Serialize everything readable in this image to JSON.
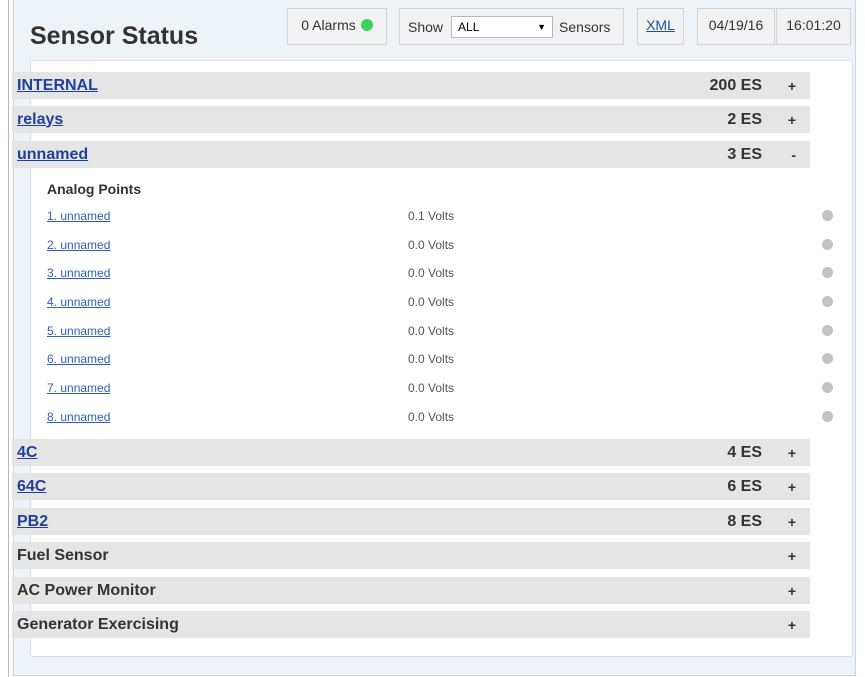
{
  "title": "Sensor Status",
  "alarms": {
    "label": "0 Alarms",
    "status_color": "#3fd35a"
  },
  "filter": {
    "show_label": "Show",
    "selected": "ALL",
    "sensors_label": "Sensors"
  },
  "xml_label": "XML",
  "date": "04/19/16",
  "time": "16:01:20",
  "groups": [
    {
      "name": "INTERNAL",
      "count": "200 ES",
      "toggle": "+"
    },
    {
      "name": "relays",
      "count": "2 ES",
      "toggle": "+"
    },
    {
      "name": "unnamed",
      "count": "3 ES",
      "toggle": "-"
    },
    {
      "name": "4C",
      "count": "4 ES",
      "toggle": "+"
    },
    {
      "name": "64C",
      "count": "6 ES",
      "toggle": "+"
    },
    {
      "name": "PB2",
      "count": "8 ES",
      "toggle": "+"
    },
    {
      "name": "Fuel Sensor",
      "count": "",
      "toggle": "+"
    },
    {
      "name": "AC Power Monitor",
      "count": "",
      "toggle": "+"
    },
    {
      "name": "Generator Exercising",
      "count": "",
      "toggle": "+"
    }
  ],
  "analog": {
    "title": "Analog Points",
    "points": [
      {
        "name": "1. unnamed",
        "value": "0.1 Volts"
      },
      {
        "name": "2. unnamed",
        "value": "0.0 Volts"
      },
      {
        "name": "3. unnamed",
        "value": "0.0 Volts"
      },
      {
        "name": "4. unnamed",
        "value": "0.0 Volts"
      },
      {
        "name": "5. unnamed",
        "value": "0.0 Volts"
      },
      {
        "name": "6. unnamed",
        "value": "0.0 Volts"
      },
      {
        "name": "7. unnamed",
        "value": "0.0 Volts"
      },
      {
        "name": "8. unnamed",
        "value": "0.0 Volts"
      }
    ]
  }
}
